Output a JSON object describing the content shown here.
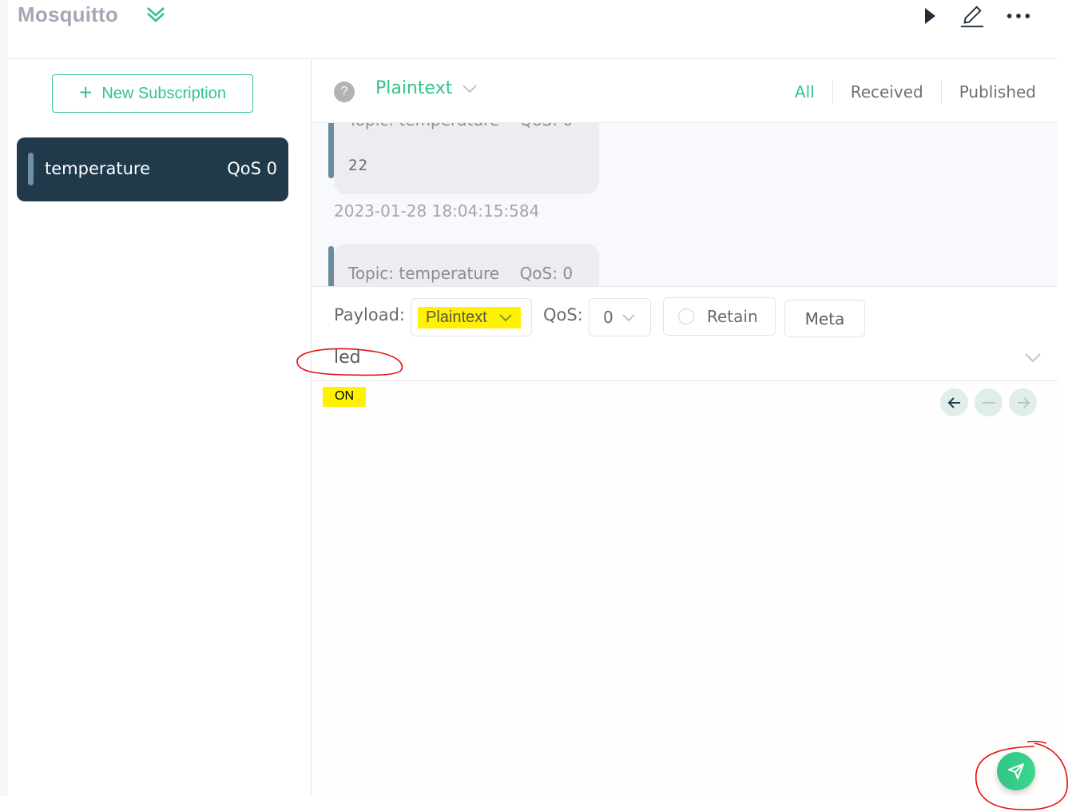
{
  "header": {
    "connection_name": "Mosquitto",
    "icons": [
      "chevrons-down-icon",
      "play-icon",
      "edit-icon",
      "more-icon"
    ]
  },
  "sidebar": {
    "new_subscription_label": "New Subscription",
    "subscriptions": [
      {
        "topic": "temperature",
        "qos_label": "QoS 0",
        "color": "#7290a3"
      }
    ]
  },
  "toolbar": {
    "help_glyph": "?",
    "format_value": "Plaintext",
    "filters": [
      {
        "label": "All",
        "active": true
      },
      {
        "label": "Received",
        "active": false
      },
      {
        "label": "Published",
        "active": false
      }
    ]
  },
  "messages": [
    {
      "topic_line": "Topic: temperature",
      "qos_line": "QoS: 0",
      "payload": "22",
      "time": "2023-01-28 18:04:15:584",
      "partial": "top"
    },
    {
      "topic_line": "Topic: temperature",
      "qos_line": "QoS: 0",
      "payload": "",
      "time": "",
      "partial": "bottom"
    }
  ],
  "publish": {
    "payload_label": "Payload:",
    "payload_format": "Plaintext",
    "qos_label": "QoS:",
    "qos_value": "0",
    "retain_label": "Retain",
    "retain_checked": false,
    "meta_label": "Meta",
    "topic_value": "led",
    "payload_value": "ON"
  },
  "colors": {
    "accent": "#34c388",
    "subscription_bg": "#203a4b",
    "annotation_red": "#e01010",
    "highlight_yellow": "#fff200"
  }
}
